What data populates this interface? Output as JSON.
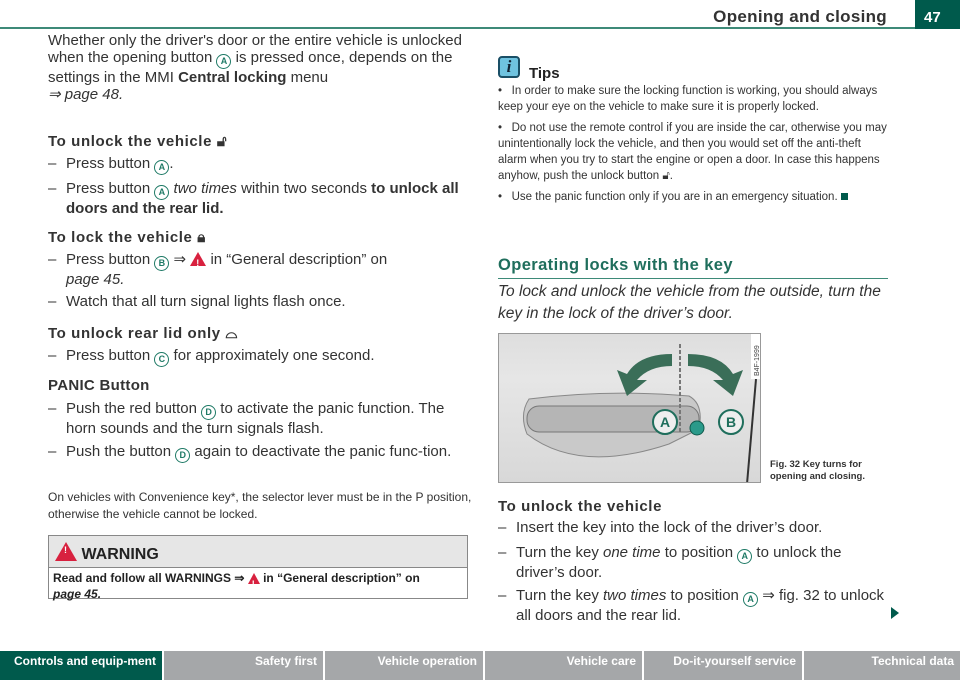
{
  "header": {
    "title": "Opening and closing",
    "page_number": "47"
  },
  "left": {
    "intro": [
      "Whether only the driver's door or the entire vehicle is unlocked when the opening button ",
      "A",
      " is pressed once, depends on the settings in the MMI ",
      "Central locking",
      " menu ",
      "⇒ page 48."
    ],
    "unlock": {
      "heading": "To unlock the vehicle",
      "items": [
        {
          "a": "Press button ",
          "b": "A",
          "c": "."
        },
        {
          "a": "Press button ",
          "b": "A",
          "i": " two times",
          "c": " within two seconds ",
          "d": "to unlock all doors and the rear lid."
        }
      ]
    },
    "lock": {
      "heading": "To lock the vehicle",
      "items": [
        {
          "a": "Press button ",
          "b": "B",
          "c": " ⇒ ",
          "d": " in “General description” on ",
          "e": "page 45."
        },
        {
          "a": "Watch that all turn signal lights flash once."
        }
      ]
    },
    "rearlid": {
      "heading": "To unlock rear lid only",
      "items": [
        {
          "a": "Press button ",
          "b": "C",
          "c": " for approximately one second."
        }
      ]
    },
    "panic": {
      "heading": "PANIC Button",
      "items": [
        {
          "a": "Push the red button ",
          "b": "D",
          "c": " to activate the panic function. The horn sounds and the turn signals flash."
        },
        {
          "a": "Push the button ",
          "b": "D",
          "c": " again to deactivate the panic func-tion."
        }
      ]
    },
    "note": "On vehicles with Convenience key*, the selector lever must be in the P position, otherwise the vehicle cannot be locked.",
    "warning": {
      "title": "WARNING",
      "a": "Read and follow all WARNINGS ⇒ ",
      "b": " in “General description” on ",
      "c": "page 45."
    }
  },
  "right": {
    "tips": {
      "title": "Tips",
      "bullets": [
        "In order to make sure the locking function is working, you should always keep your eye on the vehicle to make sure it is properly locked.",
        "Do not use the remote control if you are inside the car, otherwise you may unintentionally lock the vehicle, and then you would set off the anti-theft alarm when you try to start the engine or open a door. In case this happens anyhow, push the unlock button",
        "Use the panic function only if you are in an emergency situation."
      ]
    },
    "section_heading": "Operating locks with the key",
    "lead": "To lock and unlock the vehicle from the outside, turn the key in the lock of the driver’s door.",
    "figure": {
      "code": "B4F-1999",
      "label_a": "A",
      "label_b": "B",
      "caption": "Fig. 32  Key turns for opening and closing."
    },
    "unlock": {
      "heading": "To unlock the vehicle",
      "items": [
        {
          "a": "Insert the key into the lock of the driver’s door."
        },
        {
          "a": "Turn the key ",
          "i": "one time",
          "c": " to position ",
          "b": "A",
          "d": " to unlock the driver’s door."
        },
        {
          "a": "Turn the key ",
          "i": "two times",
          "c": " to position ",
          "b": "A",
          "d": " ⇒ fig. 32 to unlock all doors and the rear lid."
        }
      ]
    }
  },
  "footer": {
    "tabs": [
      "Controls and equip-ment",
      "Safety first",
      "Vehicle operation",
      "Vehicle care",
      "Do-it-yourself service",
      "Technical data"
    ],
    "active": 0,
    "colors": {
      "active": "#005a4c",
      "inactive": "#a5a7a9"
    }
  }
}
